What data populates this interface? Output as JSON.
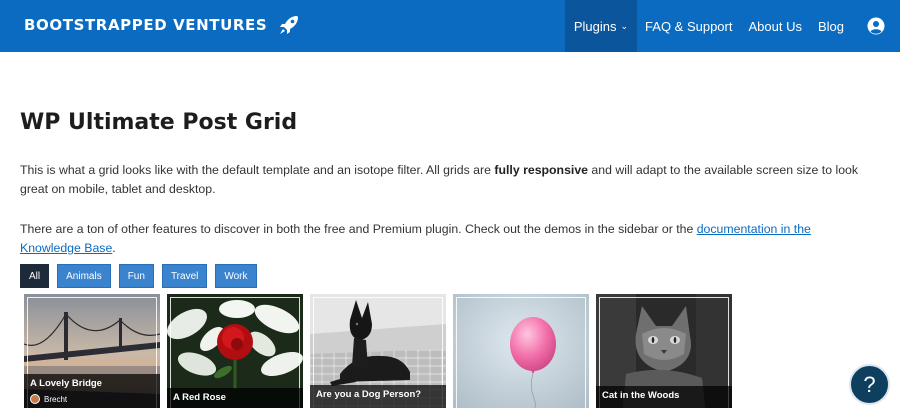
{
  "header": {
    "brand": "BOOTSTRAPPED VENTURES",
    "brand_icon": "rocket-icon",
    "nav": [
      {
        "label": "Plugins",
        "has_dropdown": true,
        "active": true
      },
      {
        "label": "FAQ & Support"
      },
      {
        "label": "About Us"
      },
      {
        "label": "Blog"
      }
    ],
    "user_icon": "user-circle-icon",
    "colors": {
      "bar": "#0a6bc1",
      "active": "#0a559b"
    }
  },
  "main": {
    "title": "WP Ultimate Post Grid",
    "para1_before": "This is what a grid looks like with the default template and an isotope filter. All grids are ",
    "para1_bold": "fully responsive",
    "para1_after": " and will adapt to the available screen size to look great on mobile, tablet and desktop.",
    "para2_before": "There are a ton of other features to discover in both the free and Premium plugin. Check out the demos in the sidebar or the ",
    "para2_link": "documentation in the Knowledge Base",
    "para2_after": "."
  },
  "filters": [
    {
      "label": "All",
      "active": true
    },
    {
      "label": "Animals"
    },
    {
      "label": "Fun"
    },
    {
      "label": "Travel"
    },
    {
      "label": "Work"
    }
  ],
  "grid": [
    {
      "title": "A Lovely Bridge",
      "author": "Brecht",
      "image": "bridge-photo"
    },
    {
      "title": "A Red Rose",
      "image": "rose-photo"
    },
    {
      "title": "Are you a Dog Person?",
      "image": "dog-photo"
    },
    {
      "title": "",
      "image": "balloon-photo"
    },
    {
      "title": "Cat in the Woods",
      "image": "cat-photo"
    }
  ],
  "help": {
    "label": "?",
    "icon": "help-icon"
  }
}
